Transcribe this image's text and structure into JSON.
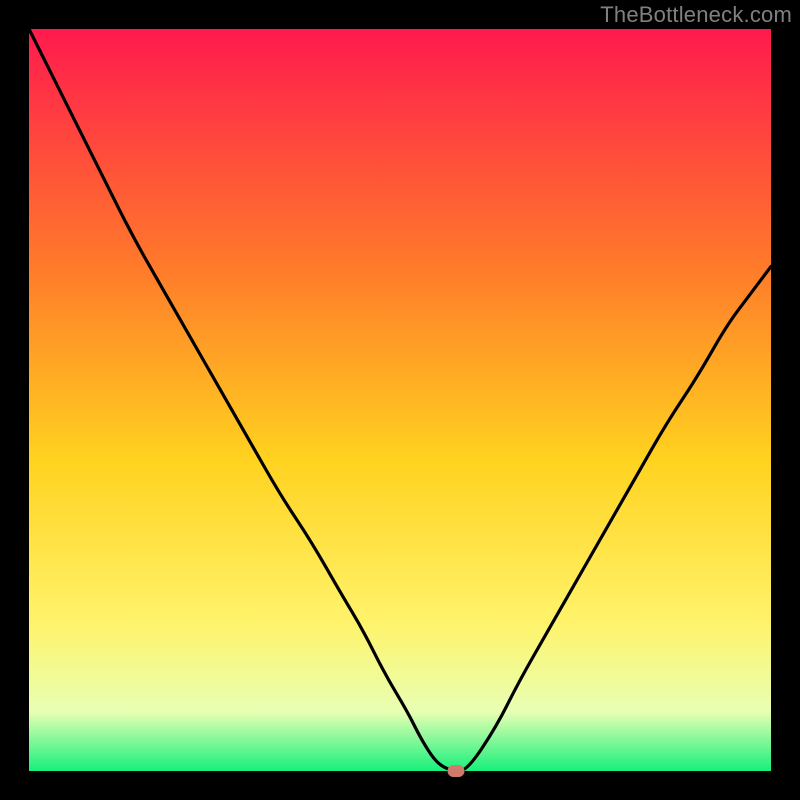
{
  "watermark": "TheBottleneck.com",
  "chart_data": {
    "type": "line",
    "title": "",
    "xlabel": "",
    "ylabel": "",
    "xlim": [
      0,
      100
    ],
    "ylim": [
      0,
      100
    ],
    "series": [
      {
        "name": "curve",
        "x": [
          0,
          3,
          6,
          10,
          14,
          18,
          22,
          26,
          30,
          34,
          38,
          42,
          45,
          48,
          51,
          53,
          55,
          57,
          59,
          63,
          66,
          70,
          74,
          78,
          82,
          86,
          90,
          94,
          97,
          100
        ],
        "y": [
          100,
          94,
          88,
          80,
          72,
          65,
          58,
          51,
          44,
          37,
          31,
          24,
          19,
          13,
          8,
          4,
          1,
          0,
          0,
          6,
          12,
          19,
          26,
          33,
          40,
          47,
          53,
          60,
          64,
          68
        ]
      }
    ],
    "marker": {
      "x": 57.5,
      "y": 0,
      "color": "#cf7a6d"
    },
    "gradient_colors": {
      "top": "#ff1a4e",
      "upper_mid": "#ff7a2a",
      "mid": "#ffd21f",
      "lower_mid": "#fff36b",
      "pale": "#e8ffb3",
      "bottom": "#17f07c"
    }
  }
}
